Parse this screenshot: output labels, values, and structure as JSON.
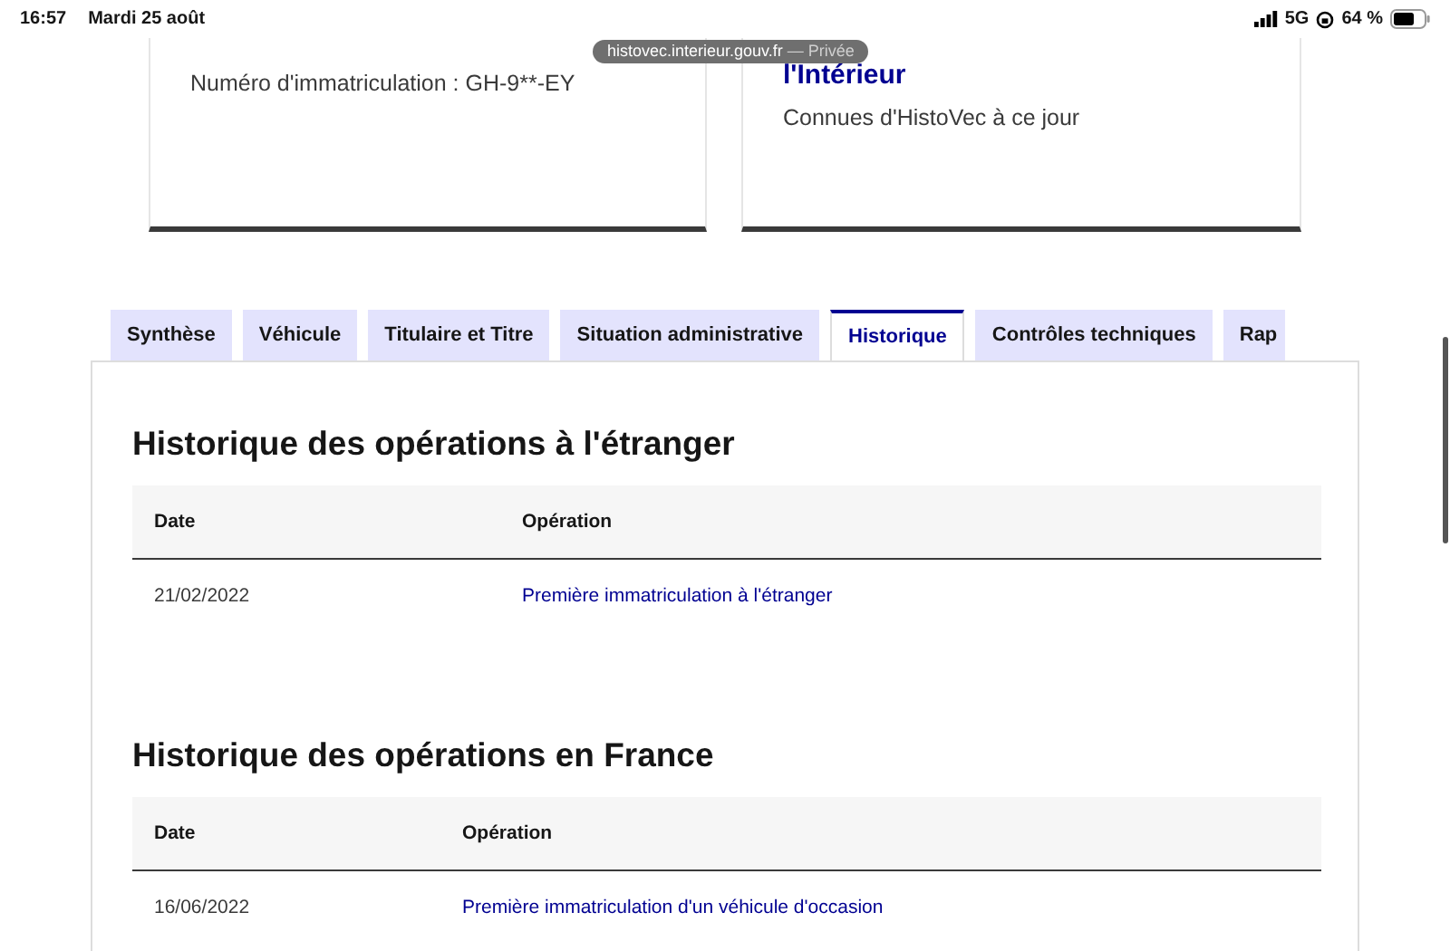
{
  "status_bar": {
    "time": "16:57",
    "date": "Mardi 25 août",
    "network": "5G",
    "battery": "64 %"
  },
  "address_pill": {
    "host": "histovec.interieur.gouv.fr",
    "mode": "— Privée"
  },
  "cards": [
    {
      "kind": "text",
      "text": "Numéro d'immatriculation : GH-9**-EY"
    },
    {
      "kind": "titled",
      "title": "l'Intérieur",
      "text": "Connues d'HistoVec à ce jour"
    }
  ],
  "tabs": [
    {
      "label": "Synthèse",
      "selected": false
    },
    {
      "label": "Véhicule",
      "selected": false
    },
    {
      "label": "Titulaire et Titre",
      "selected": false
    },
    {
      "label": "Situation administrative",
      "selected": false
    },
    {
      "label": "Historique",
      "selected": true
    },
    {
      "label": "Contrôles techniques",
      "selected": false
    },
    {
      "label": "Rap",
      "selected": false
    }
  ],
  "sections": [
    {
      "title": "Historique des opérations à l'étranger",
      "columns": [
        "Date",
        "Opération"
      ],
      "rows": [
        {
          "date": "21/02/2022",
          "operation": "Première immatriculation à l'étranger"
        }
      ]
    },
    {
      "title": "Historique des opérations en France",
      "columns": [
        "Date",
        "Opération"
      ],
      "rows": [
        {
          "date": "16/06/2022",
          "operation": "Première immatriculation d'un véhicule d'occasion"
        }
      ]
    }
  ]
}
